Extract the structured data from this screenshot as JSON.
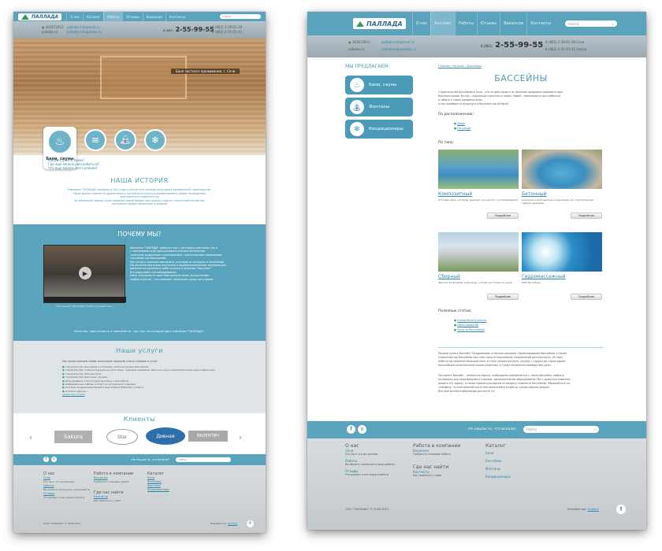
{
  "site": {
    "logo": "ПАЛЛАДА",
    "nav": [
      "О нас",
      "Каталог",
      "Работы",
      "Отзывы",
      "Вакансии",
      "Контакты"
    ],
    "search_placeholder": "Найти",
    "phone_code": "8 (862)",
    "phone": "2-55-99-55",
    "phone_sochi": "8 (862) 2-39-01-39",
    "city_sochi": "Сочи",
    "phone_adler": "8 (862) 2-41-01-41",
    "city_adler": "Адлер",
    "icq": "361672913",
    "skype": "pallada.ru",
    "email1": "pallada-info@mail.ru",
    "email2": "pallada-info@inbox.ru"
  },
  "left": {
    "slider_caption": "Баня частного проживания, г. Сочи",
    "card_title": "Бани, сауны",
    "card_links": [
      "Какую строить баню?",
      "Где еще можно расслабиться?",
      "Что еще можно для купания?"
    ],
    "history_title": "НАША ИСТОРИЯ",
    "history_text": [
      "Компания \"ПАЛЛАДА\" основана в 2001 году в результате слияния нескольких направлений строительства.",
      "Наша фирма стремится удовлетворить потребности рынка в оптимизировать сервис посредством",
      "комплексного строительства",
      "",
      "За небольшой период существования нашей фирмы нам удалось создать сплоченный коллектив,",
      "настоящих профессиональных огромный"
    ],
    "why_title": "ПОЧЕМУ МЫ?",
    "why_text": [
      "Компания \"ПАЛЛАДА\" работает как с частными клиентами, так и",
      "с компаниями культурно-развлекательного назначения,",
      "санаторно-курортными учреждениями, строительными компаниями,",
      "торговыми организациями.",
      "Мы ценим и уважаем свое время, учитывая их интересы и пожелания.",
      "",
      "Мы располагаем всеми ресурсами и профессиональными знаниями для",
      "выполнения комплекса работ высокого качества \"под ключ\".",
      "Все виды работ сертифицированы.",
      "",
      "Наши специалисты дают Вам консультации, осуществляют",
      "подбор и расчет, что позволяет сэкономить средства и время."
    ],
    "video_caption": "Фонтанный \"ПАЛЛАДА\" любит крупный план",
    "why_footer": "Качество, практичность и надежность - вот три, по которым идет компания \"ПАЛЛАДА\".",
    "services_title": "Наши услуги",
    "services_intro": "Мы предоставляем своим заказчикам широкий спектр товаров и услуг:",
    "services": [
      "строительство бассейнов и установку комплектующих бассейнов;",
      "строительство и реконструкцию русских бань, турецких хаммамов, финских саун и альпийских бань (краснофинские);",
      "строительство СПА-центров;",
      "строительство фонтанов, прудов;",
      "оборудование и аксессуары для бань и бассейнов;",
      "инфракрасные кабины и сплит из натурального дерева;",
      "системы кондиционирования и вентиляции Mitsubishi и Daikin;",
      "и многое другое..."
    ],
    "services_more": "узнать все услуги",
    "clients_title": "Клиенты",
    "clients": [
      "Sakura",
      "Star",
      "Дивная",
      "ВАЛЕНТИН"
    ]
  },
  "right": {
    "sidebar_title": "МЫ ПРЕДЛАГАЕМ:",
    "sidebar": [
      "Бани, сауны",
      "Фонтаны",
      "Кондиционеры"
    ],
    "breadcrumb": "Главная / Каталог / Бассейны",
    "page_title": "БАССЕЙНЫ",
    "intro": [
      "Строительство бассейнов в Сочи – это не дань моде и не желание продемонстрировать свое",
      "благосостояние. Летом – надежный спасения от жары. Зимой – возможность расслабиться",
      "и забыть о серых холодных днях.",
      "А как приобрести отдохнуть в бассейне после бани?"
    ],
    "loc_title": "По расположению:",
    "loc": [
      "Дома",
      "На улице"
    ],
    "type_title": "По типу:",
    "types": [
      {
        "name": "Композитный",
        "desc": "(Готовая чаша, которую привозят на участок и устанавливают)",
        "btn": "Подробнее"
      },
      {
        "name": "Бетонный",
        "desc": "(Сложное и долговечное сооружение, его строительство требует времени)",
        "btn": "Подробнее"
      },
      {
        "name": "Сборный",
        "desc": "(Быстро возводимы, мобильны, и более доступны по цене)",
        "btn": "Подробнее"
      },
      {
        "name": "Гидромассажный",
        "desc": "(SPA бассейны)",
        "btn": "Подробнее"
      }
    ],
    "art_title": "Полезные статьи:",
    "articles": [
      "Какая баня отделка",
      "Оборудование",
      "Уход за бассейном"
    ],
    "p1": [
      "Решили купить бассейн? Поздравляем, отличное решение. Проектирование бассейнов, а также",
      "строительство бассейнов под ключ одно из важнейших направлений деятельности. За годы",
      "работы мы накопили большой опыт в столь непростом деле, потому с гордостью гарантируем",
      "высочайшее качество всем нашим клиентам, а также неизменно комфортные цены."
    ],
    "p2": [
      "Построить бассейн – непростая задача, необходимо определиться с типом бассейна, выбрать",
      "материалы для производства и отделки, дополнительное оборудование. Мы с радостью поможем",
      "решить эту задачу, а также проконсультируем по вопросу стоимости бассейнов. Обращайтесь по",
      "телефону, по электронной почте или приезжайте в один из наших офисов продаж.",
      "Вся контактная информация доступна тут."
    ],
    "bottom_search_label": "Не нашли то, что искали?",
    "bottom_search_placeholder": "Найти",
    "footer": {
      "col1_title": "О нас",
      "col1": [
        "Сочи",
        "Кто мы и что мы делаем",
        "Работы",
        "Вы можете посмотреть наши работы",
        "Отзывы",
        "Что думают о нас наши клиенты"
      ],
      "col2_title": "Работа в компании",
      "col2": [
        "Вакансии",
        "Требуются толковые ребята"
      ],
      "col3_title": "Где нас найти",
      "col3": [
        "Контакты",
        "Как связаться с нами"
      ],
      "col4_title": "Каталог",
      "col4": [
        "Бани",
        "Бассейны",
        "Фонтаны",
        "Кондиционеры"
      ],
      "copyright": "ООО \"ПАЛЛАДА\" © 2005-2011",
      "dev": "Разработчик:",
      "dev_name": "Grubmy"
    }
  }
}
